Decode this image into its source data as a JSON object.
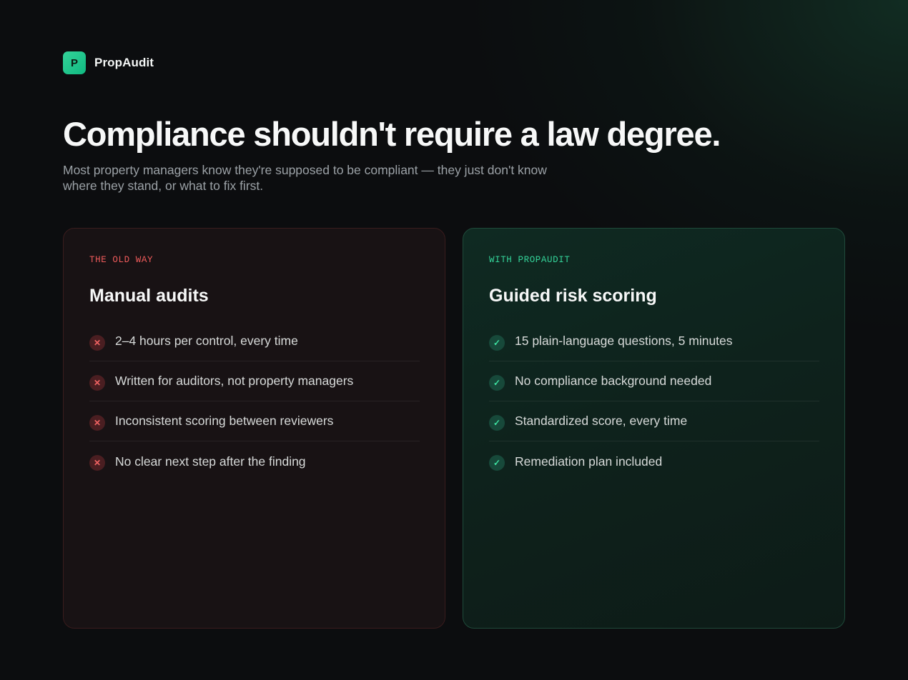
{
  "brand": {
    "logo_letter": "P",
    "name": "PropAudit",
    "accent_color": "#10b981"
  },
  "hero": {
    "headline": "Compliance shouldn't require a law degree.",
    "subhead": "Most property managers know they're supposed to be compliant — they just don't know where they stand, or what to fix first."
  },
  "old_way": {
    "eyebrow": "THE OLD WAY",
    "title": "Manual audits",
    "status_color": "#ef5b5b",
    "icon": "x-icon",
    "items": [
      "2–4 hours per control, every time",
      "Written for auditors, not property managers",
      "Inconsistent scoring between reviewers",
      "No clear next step after the finding"
    ]
  },
  "new_way": {
    "eyebrow": "WITH PROPAUDIT",
    "title": "Guided risk scoring",
    "status_color": "#34d399",
    "icon": "check-icon",
    "items": [
      "15 plain-language questions, 5 minutes",
      "No compliance background needed",
      "Standardized score, every time",
      "Remediation plan included"
    ]
  }
}
